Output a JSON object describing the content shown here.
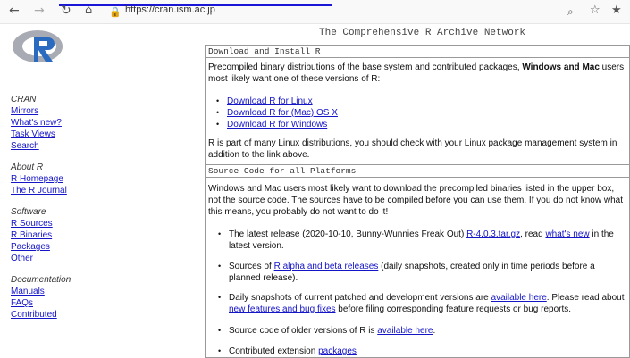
{
  "browser": {
    "url": "https://cran.ism.ac.jp",
    "icons": [
      "back-icon",
      "forward-icon",
      "reload-icon",
      "home-icon",
      "lock-icon",
      "zoom-icon",
      "star-icon",
      "favorites-icon"
    ]
  },
  "sidebar": {
    "sections": [
      {
        "heading": "CRAN",
        "links": [
          "Mirrors",
          "What's new?",
          "Task Views",
          "Search"
        ]
      },
      {
        "heading": "About R",
        "links": [
          "R Homepage",
          "The R Journal"
        ]
      },
      {
        "heading": "Software",
        "links": [
          "R Sources",
          "R Binaries",
          "Packages",
          "Other"
        ]
      },
      {
        "heading": "Documentation",
        "links": [
          "Manuals",
          "FAQs",
          "Contributed"
        ]
      }
    ]
  },
  "main": {
    "banner": "The Comprehensive R Archive Network",
    "download": {
      "title": "Download and Install R",
      "intro_pre": "Precompiled binary distributions of the base system and contributed packages, ",
      "intro_bold": "Windows and Mac",
      "intro_post": " users most likely want one of these versions of R:",
      "links": [
        "Download R for Linux",
        "Download R for (Mac) OS X",
        "Download R for Windows"
      ],
      "outro": "R is part of many Linux distributions, you should check with your Linux package management system in addition to the link above."
    },
    "source": {
      "title": "Source Code for all Platforms",
      "intro": "Windows and Mac users most likely want to download the precompiled binaries listed in the upper box, not the source code. The sources have to be compiled before you can use them. If you do not know what this means, you probably do not want to do it!",
      "items": [
        {
          "pre": "The latest release (2020-10-10, Bunny-Wunnies Freak Out) ",
          "link1": "R-4.0.3.tar.gz",
          "mid": ", read ",
          "link2": "what's new",
          "post": " in the latest version."
        },
        {
          "pre": "Sources of ",
          "link1": "R alpha and beta releases",
          "post": " (daily snapshots, created only in time periods before a planned release)."
        },
        {
          "pre": "Daily snapshots of current patched and development versions are ",
          "link1": "available here",
          "mid": ". Please read about ",
          "link2": "new features and bug fixes",
          "post": " before filing corresponding feature requests or bug reports."
        },
        {
          "pre": "Source code of older versions of R is ",
          "link1": "available here",
          "post": "."
        },
        {
          "pre": "Contributed extension ",
          "link1": "packages"
        }
      ]
    }
  }
}
